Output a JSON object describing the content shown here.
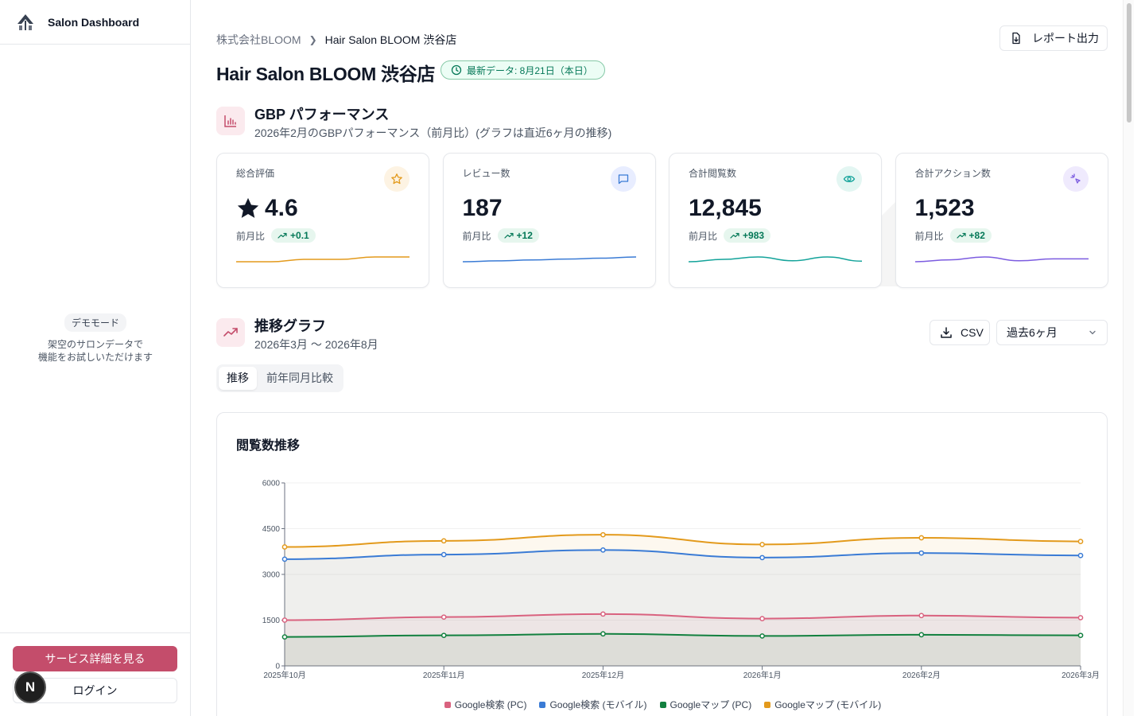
{
  "sidebar": {
    "title": "Salon Dashboard",
    "demo_badge": "デモモード",
    "demo_line1": "架空のサロンデータで",
    "demo_line2": "機能をお試しいただけます",
    "service_button": "サービス詳細を見る",
    "login_button": "ログイン",
    "avatar_letter": "N"
  },
  "header": {
    "breadcrumb_company": "株式会社BLOOM",
    "breadcrumb_store": "Hair Salon BLOOM 渋谷店",
    "report_button": "レポート出力",
    "title": "Hair Salon BLOOM 渋谷店",
    "latest_badge": "最新データ: 8月21日（本日）"
  },
  "performance": {
    "title": "GBP パフォーマンス",
    "subtitle": "2026年2月のGBPパフォーマンス（前月比）(グラフは直近6ヶ月の推移)",
    "prev_label": "前月比",
    "kpis": [
      {
        "label": "総合評価",
        "value": "4.6",
        "delta": "+0.1",
        "icon": "star-icon",
        "color": "#e39a1c",
        "icon_bg": "#fdf3e3",
        "spark": [
          4.5,
          4.5,
          4.55,
          4.55,
          4.6,
          4.6
        ]
      },
      {
        "label": "レビュー数",
        "value": "187",
        "delta": "+12",
        "icon": "message-icon",
        "color": "#3a7bd5",
        "icon_bg": "#e8edff",
        "spark": [
          160,
          165,
          170,
          175,
          180,
          187
        ]
      },
      {
        "label": "合計閲覧数",
        "value": "12,845",
        "delta": "+983",
        "icon": "eye-icon",
        "color": "#13a39a",
        "icon_bg": "#e3f6f2",
        "spark": [
          11800,
          12050,
          12300,
          11900,
          12300,
          11862
        ]
      },
      {
        "label": "合計アクション数",
        "value": "1,523",
        "delta": "+82",
        "icon": "sparkle-icon",
        "color": "#7c5ce0",
        "icon_bg": "#efeafd",
        "spark": [
          1380,
          1420,
          1480,
          1400,
          1441,
          1441
        ]
      }
    ]
  },
  "trend": {
    "title": "推移グラフ",
    "subtitle": "2026年3月 〜 2026年8月",
    "csv_button": "CSV",
    "period_select": "過去6ヶ月",
    "tabs": [
      "推移",
      "前年同月比較"
    ],
    "active_tab": 0
  },
  "chart_data": {
    "type": "area",
    "title": "閲覧数推移",
    "stacked": true,
    "x": [
      "2025年10月",
      "2025年11月",
      "2025年12月",
      "2026年1月",
      "2026年2月",
      "2026年3月"
    ],
    "ylim": [
      0,
      6000
    ],
    "yticks": [
      0,
      1500,
      3000,
      4500,
      6000
    ],
    "grid": true,
    "legend_position": "bottom",
    "series": [
      {
        "name": "Google検索 (PC)",
        "color": "#d9627f",
        "values": [
          1500,
          1600,
          1700,
          1550,
          1650,
          1580
        ]
      },
      {
        "name": "Google検索 (モバイル)",
        "color": "#3a7bd5",
        "values": [
          3500,
          3650,
          3800,
          3550,
          3700,
          3620
        ]
      },
      {
        "name": "Googleマップ (PC)",
        "color": "#12803f",
        "values": [
          950,
          1000,
          1050,
          980,
          1020,
          1000
        ]
      },
      {
        "name": "Googleマップ (モバイル)",
        "color": "#e39a1c",
        "values": [
          3900,
          4100,
          4300,
          3980,
          4200,
          4080
        ]
      }
    ]
  }
}
